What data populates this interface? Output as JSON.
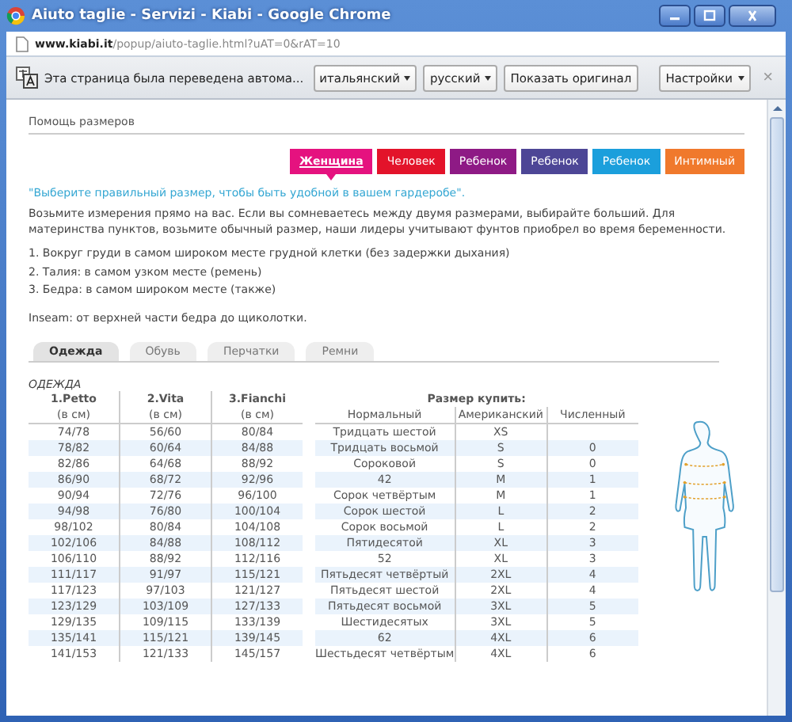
{
  "window": {
    "title": "Aiuto taglie - Servizi - Kiabi - Google Chrome"
  },
  "address_bar": {
    "domain": "www.kiabi.it",
    "path": "/popup/aiuto-taglie.html?uAT=0&rAT=10"
  },
  "translate_bar": {
    "message": "Эта страница была переведена автома...",
    "from_language": "итальянский",
    "to_language": "русский",
    "show_original": "Показать оригинал",
    "options": "Настройки",
    "close": "×"
  },
  "page": {
    "heading": "Помощь размеров",
    "categories": [
      {
        "label": "Женщина",
        "color": "#e5127f",
        "selected": true
      },
      {
        "label": "Человек",
        "color": "#e3132a",
        "selected": false
      },
      {
        "label": "Ребенок",
        "color": "#8e1a85",
        "selected": false
      },
      {
        "label": "Ребенок",
        "color": "#4d4696",
        "selected": false
      },
      {
        "label": "Ребенок",
        "color": "#1b9fdc",
        "selected": false
      },
      {
        "label": "Интимный",
        "color": "#f0792c",
        "selected": false
      }
    ],
    "quote": "\"Выберите правильный размер, чтобы быть удобной в вашем гардеробе\".",
    "intro": "Возьмите измерения прямо на вас. Если вы сомневаетесь между двумя размерами, выбирайте больший. Для материнства пунктов, возьмите обычный размер, наши лидеры учитывают фунтов приобрел во время беременности.",
    "steps": [
      "1. Вокруг груди в самом широком месте грудной клетки (без задержки дыхания)",
      "2. Талия: в самом узком месте (ремень)",
      "3. Бедра: в самом широком месте (также)"
    ],
    "inseam": "Inseam: от верхней части бедра до щиколотки.",
    "tabs": [
      {
        "label": "Одежда",
        "selected": true
      },
      {
        "label": "Обувь",
        "selected": false
      },
      {
        "label": "Перчатки",
        "selected": false
      },
      {
        "label": "Ремни",
        "selected": false
      }
    ],
    "section_title": "ОДЕЖДА",
    "size_title": "Размер купить:",
    "columns": [
      {
        "name": "1.Petto",
        "unit": "(в см)"
      },
      {
        "name": "2.Vita",
        "unit": "(в см)"
      },
      {
        "name": "3.Fianchi",
        "unit": "(в см)"
      }
    ],
    "size_columns": [
      "Нормальный",
      "Американский",
      "Численный"
    ],
    "rows": [
      [
        "74/78",
        "56/60",
        "80/84",
        "Тридцать шестой",
        "XS",
        ""
      ],
      [
        "78/82",
        "60/64",
        "84/88",
        "Тридцать восьмой",
        "S",
        "0"
      ],
      [
        "82/86",
        "64/68",
        "88/92",
        "Сороковой",
        "S",
        "0"
      ],
      [
        "86/90",
        "68/72",
        "92/96",
        "42",
        "M",
        "1"
      ],
      [
        "90/94",
        "72/76",
        "96/100",
        "Сорок четвёртым",
        "M",
        "1"
      ],
      [
        "94/98",
        "76/80",
        "100/104",
        "Сорок шестой",
        "L",
        "2"
      ],
      [
        "98/102",
        "80/84",
        "104/108",
        "Сорок восьмой",
        "L",
        "2"
      ],
      [
        "102/106",
        "84/88",
        "108/112",
        "Пятидесятой",
        "XL",
        "3"
      ],
      [
        "106/110",
        "88/92",
        "112/116",
        "52",
        "XL",
        "3"
      ],
      [
        "111/117",
        "91/97",
        "115/121",
        "Пятьдесят четвёртый",
        "2XL",
        "4"
      ],
      [
        "117/123",
        "97/103",
        "121/127",
        "Пятьдесят шестой",
        "2XL",
        "4"
      ],
      [
        "123/129",
        "103/109",
        "127/133",
        "Пятьдесят восьмой",
        "3XL",
        "5"
      ],
      [
        "129/135",
        "109/115",
        "133/139",
        "Шестидесятых",
        "3XL",
        "5"
      ],
      [
        "135/141",
        "115/121",
        "139/145",
        "62",
        "4XL",
        "6"
      ],
      [
        "141/153",
        "121/133",
        "145/157",
        "Шестьдесят четвёртым",
        "4XL",
        "6"
      ]
    ]
  }
}
